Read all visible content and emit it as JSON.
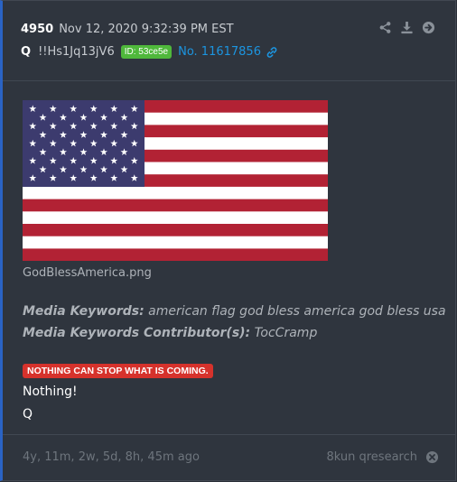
{
  "post": {
    "number": "4950",
    "timestamp": "Nov 12, 2020 9:32:39 PM EST",
    "author": "Q",
    "tripcode": "!!Hs1Jq13jV6",
    "id_badge": "ID: 53ce5e",
    "post_link": "No. 11617856"
  },
  "media": {
    "filename": "GodBlessAmerica.png",
    "keywords_label": "Media Keywords:",
    "keywords": "american flag god bless america god bless usa",
    "contributor_label": "Media Keywords Contributor(s):",
    "contributor": "TocCramp"
  },
  "content": {
    "red_label": "NOTHING CAN STOP WHAT IS COMING.",
    "line1": "Nothing!",
    "line2": "Q"
  },
  "footer": {
    "age": "4y, 11m, 2w, 5d, 8h, 45m ago",
    "board": "8kun qresearch"
  },
  "icons": {
    "share": "share-icon",
    "download": "download-icon",
    "goto": "arrow-right-circle-icon",
    "link": "link-icon",
    "close": "close-icon"
  },
  "colors": {
    "accent_border": "#2a63c4",
    "id_badge": "#4fb83b",
    "red_label": "#d6322c",
    "link": "#1c95e0"
  }
}
